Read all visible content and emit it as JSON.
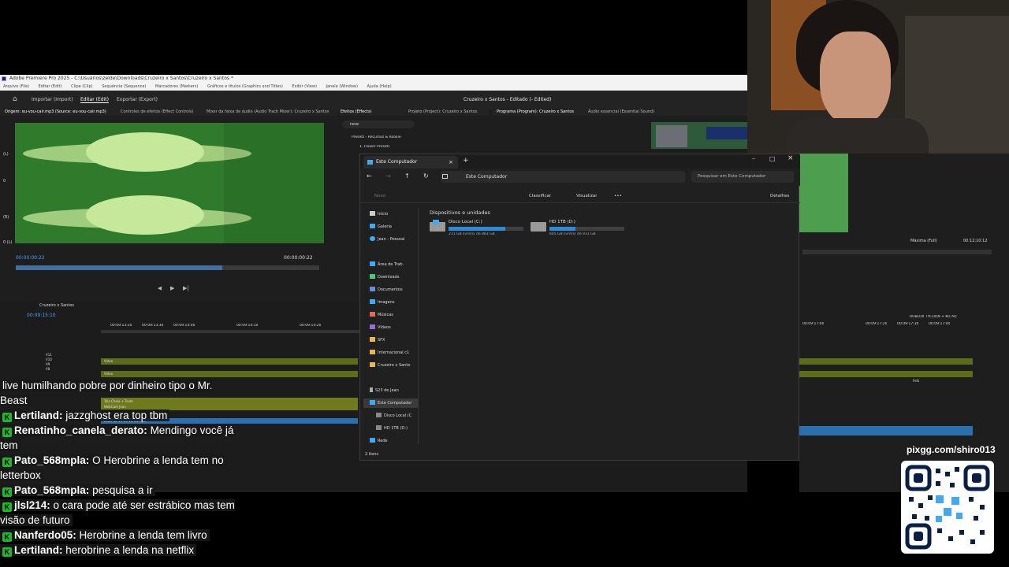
{
  "premiere": {
    "title": "Adobe Premiere Pro 2025 - C:\\Usuários\\zelde\\Downloads\\Cruzeiro x Santos\\Cruzeiro x Santos *",
    "menu": [
      "Arquivo (File)",
      "Editar (Edit)",
      "Clipe (Clip)",
      "Sequência (Sequence)",
      "Marcadores (Markers)",
      "Gráficos e títulos (Graphics and Titles)",
      "Exibir (View)",
      "Janela (Window)",
      "Ajuda (Help)"
    ],
    "workspace_tabs": [
      "Importar (Import)",
      "Editar (Edit)",
      "Exportar (Export)"
    ],
    "project_status": "Cruzeiro x Santos - Editado (- Edited)",
    "source_tabs": [
      "Origem: eu-vou-cair.mp3 (Source: eu-vou-cair.mp3)",
      "Controles de efeitos (Effect Controls)",
      "Mixer da faixa de áudio (Audio Track Mixer): Cruzeiro x Santos"
    ],
    "effects_tabs": [
      "Efeitos (Effects)",
      "Projeto (Project): Cruzeiro x Santos"
    ],
    "effects_search": "reve",
    "effects_tree": [
      "Presets - Recursos & Rookie",
      "1. Flower Presets"
    ],
    "program_tabs": [
      "Programa (Program): Cruzeiro x Santos",
      "Áudio essencial (Essential Sound)"
    ],
    "source_tc_left": "00:00:00:22",
    "source_tc_right": "00:00:00:22",
    "program_zoom": "Máxima (Full)",
    "program_tc": "00:12:10:12",
    "sequence_tab": "Cruzeiro x Santos",
    "timeline_tc": "00:09:15:10",
    "ruler": [
      "00:09:13:20",
      "00:09:13:30",
      "00:09:14:00",
      "00:09:14:10",
      "00:09:14:20"
    ],
    "ruler_right": [
      "00:09:17:00",
      "00:09:17:20",
      "00:09:17:30",
      "00:09:17:40"
    ],
    "track_labels": [
      "V11",
      "V10",
      "V9",
      "V8"
    ],
    "clip_labels": [
      "Vídeo",
      "Vídeo",
      "Tela Cheia + Texto",
      "WebCam Jean",
      "2025-06-19 13-10-33.mp4"
    ],
    "right_clip_labels": [
      "ROBLOX TYCOON + KO AO",
      "Vídeo",
      "Fefo"
    ],
    "audio_labels": [
      "A1",
      "A2"
    ],
    "waveform_labels": [
      "(L)",
      "0",
      "(R)",
      "0 (L)",
      "(R)"
    ]
  },
  "explorer": {
    "tab_title": "Este Computador",
    "breadcrumb": "Este Computador",
    "search_placeholder": "Pesquisar em Este Computador",
    "toolbar": {
      "new": "Novo",
      "sort": "Classificar",
      "view": "Visualizar",
      "more": "•••",
      "details": "Detalhes"
    },
    "section_title": "Dispositivos e unidades",
    "drives": [
      {
        "name": "Disco Local (C:)",
        "free": "211 GB livre(s) de 883 GB",
        "used_pct": 76
      },
      {
        "name": "HD 1TB (D:)",
        "free": "605 GB livre(s) de 931 GB",
        "used_pct": 35
      }
    ],
    "sidebar": [
      {
        "label": "Início",
        "icon": "home"
      },
      {
        "label": "Galeria",
        "icon": "gallery"
      },
      {
        "label": "Jean - Pessoal",
        "icon": "cloud"
      },
      {
        "label": "Área de Trab.",
        "icon": "desktop"
      },
      {
        "label": "Downloads",
        "icon": "download"
      },
      {
        "label": "Documentos",
        "icon": "document"
      },
      {
        "label": "Imagens",
        "icon": "image"
      },
      {
        "label": "Músicas",
        "icon": "music"
      },
      {
        "label": "Vídeos",
        "icon": "video"
      },
      {
        "label": "SFX",
        "icon": "folder"
      },
      {
        "label": "Internacional c1",
        "icon": "folder"
      },
      {
        "label": "Cruzeiro x Santo",
        "icon": "folder"
      },
      {
        "label": "S23 de Jean",
        "icon": "phone"
      },
      {
        "label": "Este Computador",
        "icon": "computer"
      },
      {
        "label": "Disco Local (C",
        "icon": "drive"
      },
      {
        "label": "HD 1TB (D:)",
        "icon": "drive"
      },
      {
        "label": "Rede",
        "icon": "network"
      }
    ],
    "status": "2 itens"
  },
  "chat": [
    {
      "user": "",
      "msg": "live humilhando pobre por dinheiro tipo o Mr. Beast"
    },
    {
      "user": "Lertiland:",
      "msg": "jazzghost era top tbm"
    },
    {
      "user": "Renatinho_canela_derato:",
      "msg": "Mendingo você já tem"
    },
    {
      "user": "Pato_568mpla:",
      "msg": "O Herobrine a lenda tem no letterbox"
    },
    {
      "user": "Pato_568mpla:",
      "msg": "pesquisa a ir"
    },
    {
      "user": "jlsl214:",
      "msg": "o cara pode até ser estrábico mas tem visão de futuro"
    },
    {
      "user": "Nanferdo05:",
      "msg": "Herobrine a lenda tem livro"
    },
    {
      "user": "Lertiland:",
      "msg": "herobrine a lenda na netflix"
    }
  ],
  "chat_badge": "K",
  "qr_url": "pixgg.com/shiro013",
  "colors": {
    "waveform_bg": "#2f7a2b",
    "waveform": "#c6e89a",
    "explorer_bg": "#202020",
    "accent": "#2c8cdb",
    "twitch_badge": "#1fb82c"
  }
}
